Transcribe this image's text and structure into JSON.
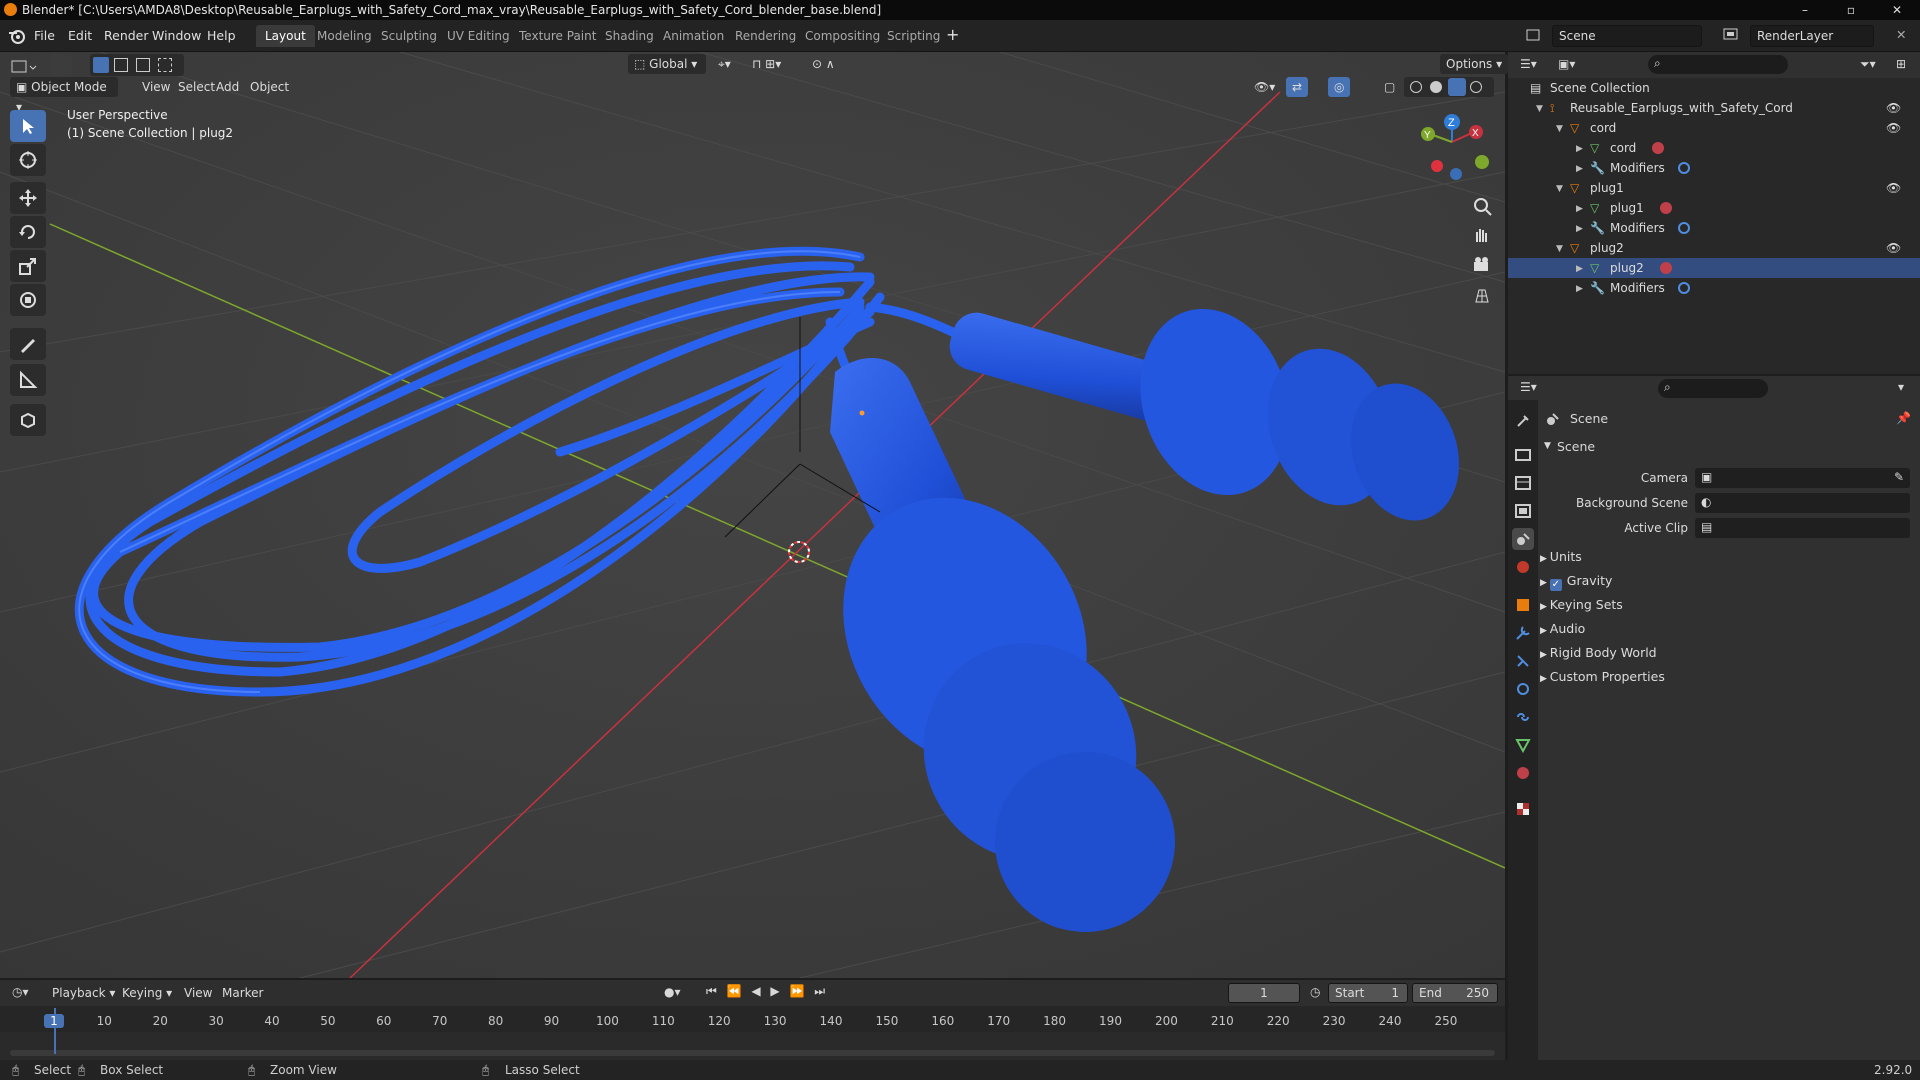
{
  "app": {
    "window_title": "Blender* [C:\\Users\\AMDA8\\Desktop\\Reusable_Earplugs_with_Safety_Cord_max_vray\\Reusable_Earplugs_with_Safety_Cord_blender_base.blend]",
    "version": "2.92.0"
  },
  "menubar": {
    "menus": [
      "File",
      "Edit",
      "Render",
      "Window",
      "Help"
    ],
    "workspaces": [
      "Layout",
      "Modeling",
      "Sculpting",
      "UV Editing",
      "Texture Paint",
      "Shading",
      "Animation",
      "Rendering",
      "Compositing",
      "Scripting"
    ],
    "active_workspace": "Layout",
    "scene_name": "Scene",
    "view_layer": "RenderLayer"
  },
  "viewport": {
    "mode": "Object Mode",
    "menus": [
      "View",
      "Select",
      "Add",
      "Object"
    ],
    "orientation": "Global",
    "options_label": "Options",
    "overlay_line1": "User Perspective",
    "overlay_line2": "(1) Scene Collection | plug2",
    "gizmo_z": "Z",
    "gizmo_y": "Y",
    "gizmo_x": "X"
  },
  "outliner": {
    "rows": [
      {
        "label": "Scene Collection",
        "icon": "collection-icon",
        "indent": 0
      },
      {
        "label": "Reusable_Earplugs_with_Safety_Cord",
        "icon": "object-icon",
        "indent": 1
      },
      {
        "label": "cord",
        "icon": "mesh-object-icon",
        "indent": 2
      },
      {
        "label": "cord",
        "icon": "mesh-data-icon",
        "indent": 3
      },
      {
        "label": "Modifiers",
        "icon": "wrench-icon",
        "indent": 3
      },
      {
        "label": "plug1",
        "icon": "mesh-object-icon",
        "indent": 2
      },
      {
        "label": "plug1",
        "icon": "mesh-data-icon",
        "indent": 3
      },
      {
        "label": "Modifiers",
        "icon": "wrench-icon",
        "indent": 3
      },
      {
        "label": "plug2",
        "icon": "mesh-object-icon",
        "indent": 2
      },
      {
        "label": "plug2",
        "icon": "mesh-data-icon",
        "indent": 3
      },
      {
        "label": "Modifiers",
        "icon": "wrench-icon",
        "indent": 3
      }
    ]
  },
  "properties": {
    "header": "Scene",
    "section": "Scene",
    "fields": [
      {
        "label": "Camera",
        "value": ""
      },
      {
        "label": "Background Scene",
        "value": ""
      },
      {
        "label": "Active Clip",
        "value": ""
      }
    ],
    "panels": [
      "Units",
      "Gravity",
      "Keying Sets",
      "Audio",
      "Rigid Body World",
      "Custom Properties"
    ],
    "gravity_checked": true
  },
  "timeline": {
    "menus": [
      "Playback",
      "Keying",
      "View",
      "Marker"
    ],
    "current_frame": "1",
    "start_label": "Start",
    "start": "1",
    "end_label": "End",
    "end": "250",
    "ticks": [
      "1",
      "10",
      "20",
      "30",
      "40",
      "50",
      "60",
      "70",
      "80",
      "90",
      "100",
      "110",
      "120",
      "130",
      "140",
      "150",
      "160",
      "170",
      "180",
      "190",
      "200",
      "210",
      "220",
      "230",
      "240",
      "250"
    ]
  },
  "statusbar": {
    "select": "Select",
    "box_select": "Box Select",
    "zoom_view": "Zoom View",
    "lasso_select": "Lasso Select"
  },
  "colors": {
    "accent": "#4772b3",
    "model_blue": "#1f56e0",
    "x_axis": "#c8323e",
    "y_axis": "#7ea82c",
    "z_axis": "#2e7dd8"
  }
}
